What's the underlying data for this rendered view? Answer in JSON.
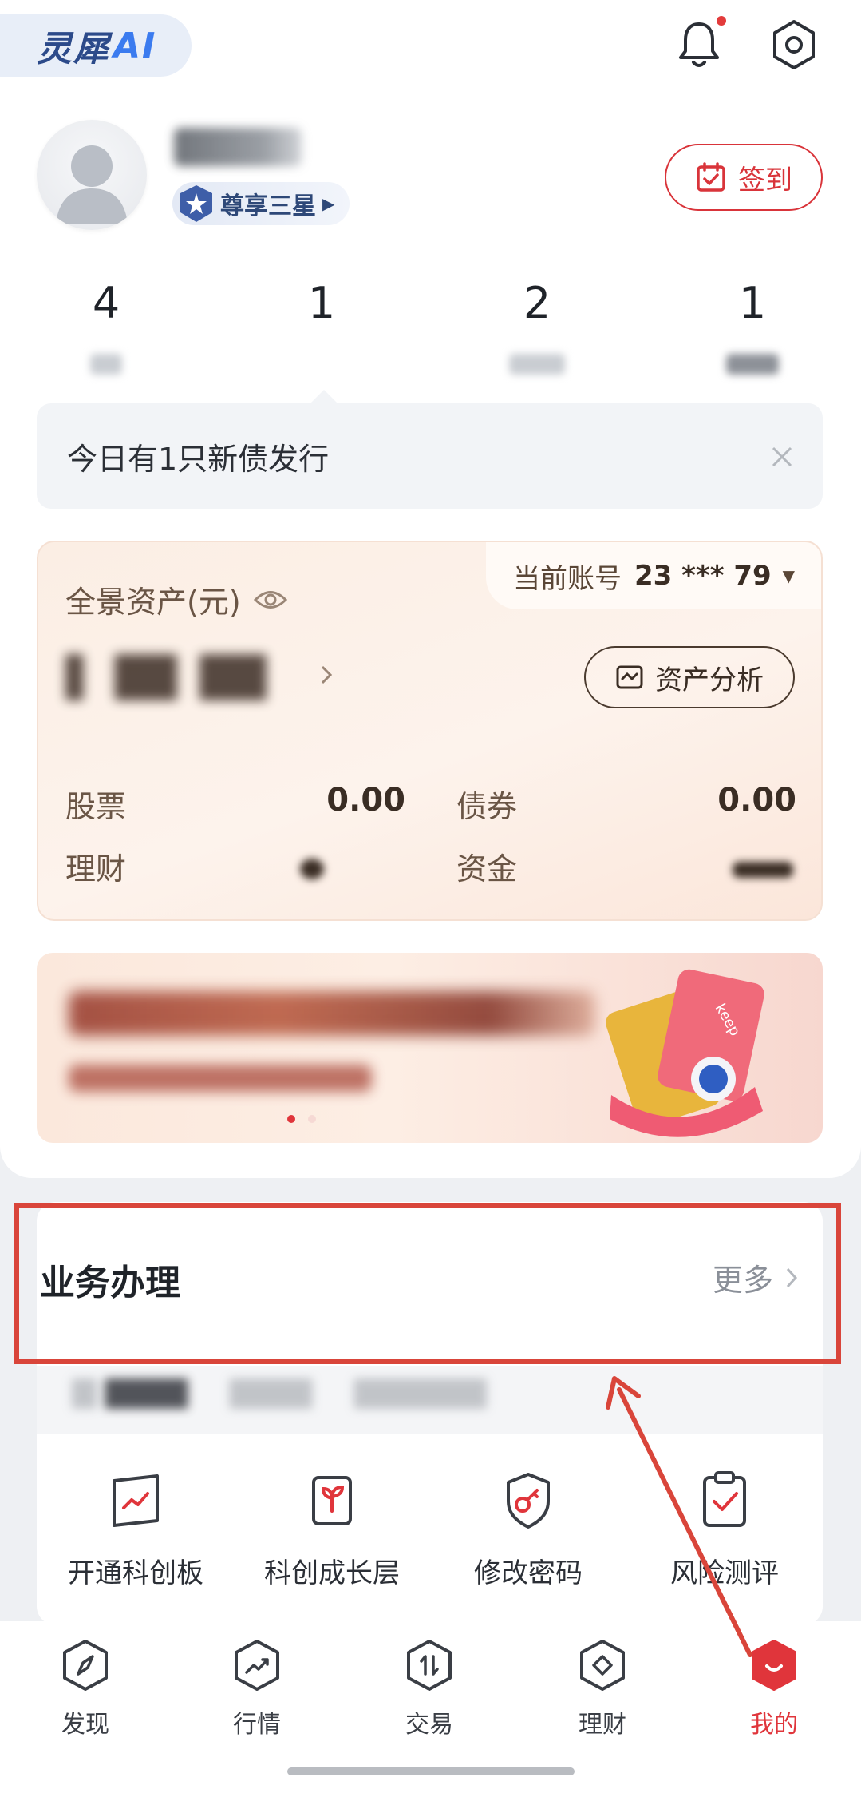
{
  "brand": {
    "name_cn": "灵犀",
    "name_ai": "AI"
  },
  "header": {
    "bell_icon": "bell-icon",
    "settings_icon": "settings-icon",
    "has_unread": true
  },
  "profile": {
    "level_label": "尊享三星",
    "checkin_label": "签到"
  },
  "stats": [
    {
      "value": "4"
    },
    {
      "value": "1"
    },
    {
      "value": "2"
    },
    {
      "value": "1"
    }
  ],
  "notice": {
    "text": "今日有1只新债发行"
  },
  "assets": {
    "title": "全景资产(元)",
    "account_label": "当前账号",
    "account_number": "23 *** 79",
    "analysis_label": "资产分析",
    "rows": [
      {
        "label": "股票",
        "value": "0.00"
      },
      {
        "label": "债券",
        "value": "0.00"
      },
      {
        "label": "理财",
        "value": ""
      },
      {
        "label": "资金",
        "value": ""
      }
    ]
  },
  "banner": {
    "dots": 2,
    "active_dot": 0,
    "brand_text": "keep"
  },
  "business": {
    "title": "业务办理",
    "more_label": "更多",
    "items": [
      {
        "label": "开通科创板",
        "icon": "chart-board-icon"
      },
      {
        "label": "科创成长层",
        "icon": "sprout-chip-icon"
      },
      {
        "label": "修改密码",
        "icon": "key-shield-icon"
      },
      {
        "label": "风险测评",
        "icon": "clipboard-check-icon"
      }
    ]
  },
  "tabs": [
    {
      "label": "发现",
      "icon": "compass-icon"
    },
    {
      "label": "行情",
      "icon": "trend-icon"
    },
    {
      "label": "交易",
      "icon": "exchange-icon"
    },
    {
      "label": "理财",
      "icon": "diamond-icon"
    },
    {
      "label": "我的",
      "icon": "smile-icon",
      "active": true
    }
  ],
  "colors": {
    "accent": "#e0353b",
    "highlight": "#d9453a"
  }
}
